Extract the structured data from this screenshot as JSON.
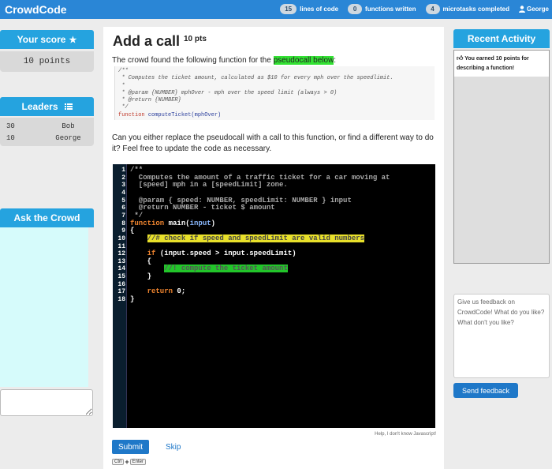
{
  "app": {
    "name": "CrowdCode"
  },
  "stats": [
    {
      "count": "15",
      "label": "lines of code"
    },
    {
      "count": "0",
      "label": "functions written"
    },
    {
      "count": "4",
      "label": "microtasks completed"
    }
  ],
  "user": {
    "name": "George"
  },
  "score": {
    "title": "Your score",
    "value": "10 points"
  },
  "leaders": {
    "title": "Leaders",
    "rows": [
      {
        "score": "30",
        "name": "Bob"
      },
      {
        "score": "10",
        "name": "George"
      }
    ]
  },
  "ask": {
    "title": "Ask the Crowd"
  },
  "task": {
    "title": "Add a call",
    "points": "10 pts",
    "intro_prefix": "The crowd found the following function for the ",
    "intro_highlight": "pseudocall below",
    "intro_suffix": ":",
    "snippet": {
      "comment_lines": [
        "/**",
        " * Computes the ticket amount, calculated as $10 for every mph over the speedlimit.",
        " *",
        " * @param {NUMBER} mphOver - mph over the speed limit (always > 0)",
        " * @return {NUMBER}",
        " */"
      ],
      "keyword": "function",
      "signature": "computeTicket(mphOver)"
    },
    "question": "Can you either replace the pseudocall with a call to this function, or find a different way to do it? Feel free to update the code as necessary.",
    "help_link": "Help, I don't know Javascript!",
    "submit_label": "Submit",
    "skip_label": "Skip",
    "shortcut": {
      "key1": "Ctrl",
      "plus": "+",
      "key2": "Enter"
    }
  },
  "editor": {
    "lines": [
      {
        "n": "1",
        "parts": [
          {
            "t": "/**",
            "c": "c-cm"
          }
        ]
      },
      {
        "n": "2",
        "parts": [
          {
            "t": "  Computes the amount of a traffic ticket for a car moving at",
            "c": "c-cm"
          }
        ]
      },
      {
        "n": "3",
        "parts": [
          {
            "t": "  [speed] mph in a [speedLimit] zone.",
            "c": "c-cm"
          }
        ]
      },
      {
        "n": "4",
        "parts": [
          {
            "t": "",
            "c": "c-cm"
          }
        ]
      },
      {
        "n": "5",
        "parts": [
          {
            "t": "  @param { speed: NUMBER, speedLimit: NUMBER } input",
            "c": "c-cm"
          }
        ]
      },
      {
        "n": "6",
        "parts": [
          {
            "t": "  @return NUMBER - ticket $ amount",
            "c": "c-cm"
          }
        ]
      },
      {
        "n": "7",
        "parts": [
          {
            "t": " */",
            "c": "c-cm"
          }
        ]
      },
      {
        "n": "8",
        "parts": [
          {
            "t": "function",
            "c": "c-kw"
          },
          {
            "t": " main(",
            "c": "c-fn"
          },
          {
            "t": "input",
            "c": "c-blue"
          },
          {
            "t": ")",
            "c": "c-fn"
          }
        ]
      },
      {
        "n": "9",
        "parts": [
          {
            "t": "{",
            "c": "c-pl"
          }
        ]
      },
      {
        "n": "10",
        "parts": [
          {
            "t": "    ",
            "c": "c-pl"
          },
          {
            "t": "//# check if speed and speedLimit are valid numbers",
            "c": "hl-yellow"
          }
        ]
      },
      {
        "n": "11",
        "parts": [
          {
            "t": "",
            "c": "c-pl"
          }
        ]
      },
      {
        "n": "12",
        "parts": [
          {
            "t": "    ",
            "c": "c-pl"
          },
          {
            "t": "if",
            "c": "c-kw"
          },
          {
            "t": " (input.speed > input.speedLimit)",
            "c": "c-pl"
          }
        ]
      },
      {
        "n": "13",
        "parts": [
          {
            "t": "    {",
            "c": "c-pl"
          }
        ]
      },
      {
        "n": "14",
        "parts": [
          {
            "t": "        ",
            "c": "c-pl"
          },
          {
            "t": "//! compute the ticket amount",
            "c": "hl-code-green"
          }
        ]
      },
      {
        "n": "15",
        "parts": [
          {
            "t": "    }",
            "c": "c-pl"
          }
        ]
      },
      {
        "n": "16",
        "parts": [
          {
            "t": "",
            "c": "c-pl"
          }
        ]
      },
      {
        "n": "17",
        "parts": [
          {
            "t": "    ",
            "c": "c-pl"
          },
          {
            "t": "return",
            "c": "c-kw"
          },
          {
            "t": " 0;",
            "c": "c-pl"
          }
        ]
      },
      {
        "n": "18",
        "parts": [
          {
            "t": "}",
            "c": "c-pl"
          }
        ]
      }
    ]
  },
  "activity": {
    "title": "Recent Activity",
    "items": [
      {
        "icon": "thumbs-up-icon",
        "text": "You earned 10 points for describing a function!"
      }
    ]
  },
  "feedback": {
    "placeholder": "Give us feedback on CrowdCode! What do you like? What don't you like?",
    "send_label": "Send feedback"
  },
  "colors": {
    "brand": "#2a86d6",
    "panel_header": "#25a3df",
    "button": "#1f78c8"
  }
}
